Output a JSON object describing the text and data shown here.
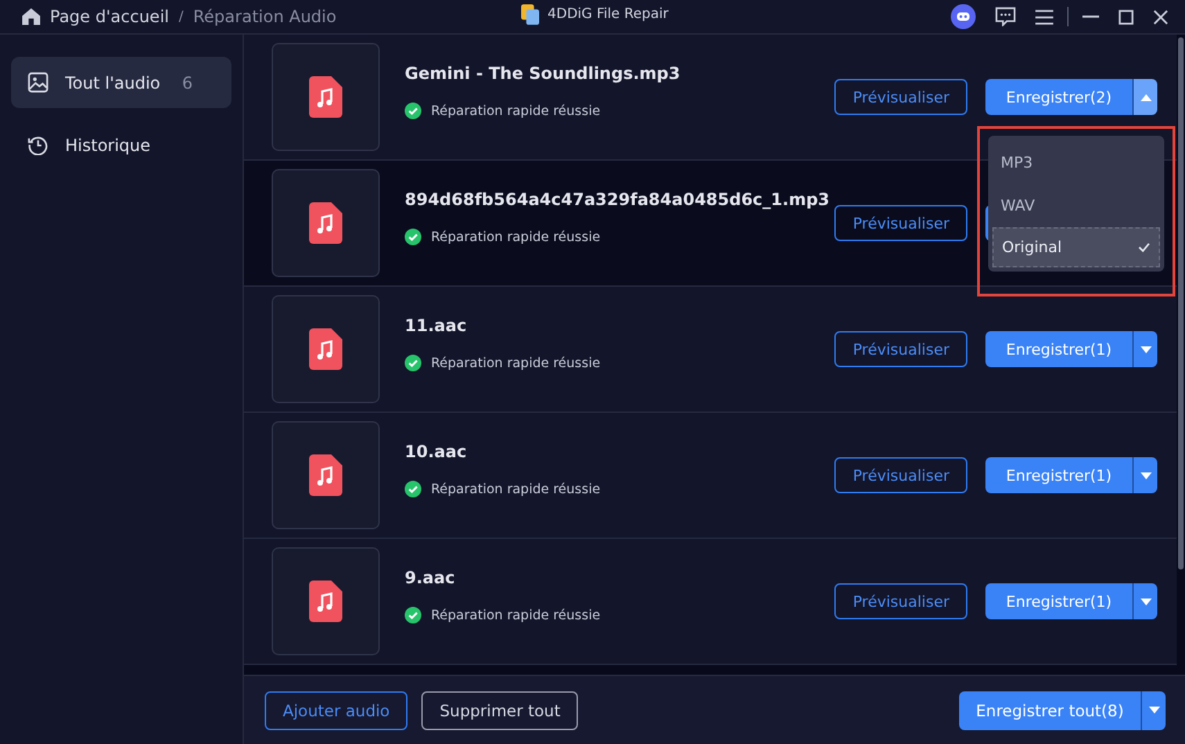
{
  "breadcrumb": {
    "home": "Page d'accueil",
    "separator": "/",
    "current": "Réparation Audio"
  },
  "window": {
    "title": "4DDiG File Repair"
  },
  "sidebar": {
    "items": [
      {
        "label": "Tout l'audio",
        "count": "6",
        "selected": true
      },
      {
        "label": "Historique",
        "selected": false
      }
    ]
  },
  "files": [
    {
      "name": "Gemini - The Soundlings.mp3",
      "status": "Réparation rapide réussie",
      "preview": "Prévisualiser",
      "save": "Enregistrer(2)",
      "expanded": true,
      "highlighted": false
    },
    {
      "name": "894d68fb564a4c47a329fa84a0485d6c_1.mp3",
      "status": "Réparation rapide réussie",
      "preview": "Prévisualiser",
      "expanded": false,
      "highlighted": true
    },
    {
      "name": "11.aac",
      "status": "Réparation rapide réussie",
      "preview": "Prévisualiser",
      "save": "Enregistrer(1)",
      "expanded": false,
      "highlighted": false
    },
    {
      "name": "10.aac",
      "status": "Réparation rapide réussie",
      "preview": "Prévisualiser",
      "save": "Enregistrer(1)",
      "expanded": false,
      "highlighted": false
    },
    {
      "name": "9.aac",
      "status": "Réparation rapide réussie",
      "preview": "Prévisualiser",
      "save": "Enregistrer(1)",
      "expanded": false,
      "highlighted": false
    }
  ],
  "format_menu": {
    "options": [
      {
        "label": "MP3",
        "selected": false
      },
      {
        "label": "WAV",
        "selected": false
      },
      {
        "label": "Original",
        "selected": true
      }
    ]
  },
  "footer": {
    "add": "Ajouter audio",
    "remove_all": "Supprimer tout",
    "save_all": "Enregistrer tout(8)"
  }
}
